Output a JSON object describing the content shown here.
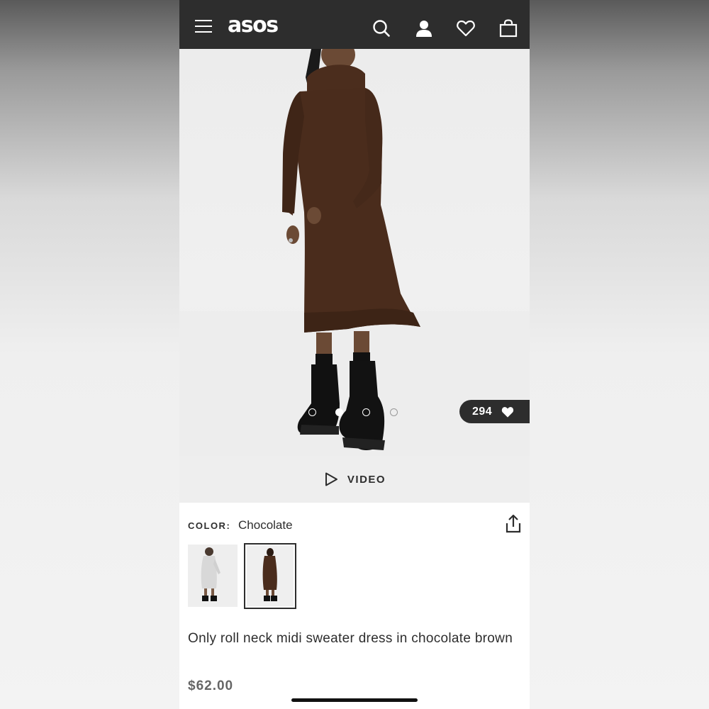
{
  "header": {
    "logo": "asos",
    "icons": [
      "menu-icon",
      "search-icon",
      "account-icon",
      "heart-icon",
      "bag-icon"
    ]
  },
  "gallery": {
    "like_count": "294",
    "image_count": 4,
    "active_index": 1
  },
  "video": {
    "label": "VIDEO"
  },
  "product": {
    "color_label": "COLOR:",
    "color_value": "Chocolate",
    "title": "Only roll neck midi sweater dress in chocolate brown",
    "price": "$62.00",
    "swatches": [
      {
        "name": "grey",
        "selected": false
      },
      {
        "name": "chocolate",
        "selected": true
      }
    ]
  },
  "colors": {
    "header_bg": "#2d2d2d",
    "dress_brown": "#4a2c1c",
    "text": "#2d2d2d",
    "price": "#666666"
  }
}
